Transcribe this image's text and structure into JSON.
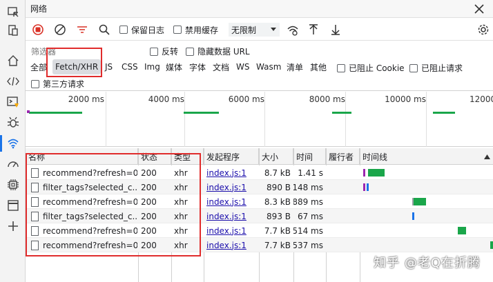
{
  "sidebar": {
    "icons": [
      "inspect-icon",
      "device-icon",
      "home-icon",
      "elements-icon",
      "console-icon",
      "sources-icon",
      "network-icon",
      "performance-icon",
      "memory-icon",
      "application-icon",
      "add-icon"
    ]
  },
  "panel": {
    "title": "网络"
  },
  "toolbar": {
    "preserve_log": "保留日志",
    "disable_cache": "禁用缓存",
    "throttle": "无限制"
  },
  "filter": {
    "placeholder": "筛选器",
    "invert": "反转",
    "hide_data_urls": "隐藏数据 URL",
    "types": [
      "全部",
      "Fetch/XHR",
      "JS",
      "CSS",
      "Img",
      "媒体",
      "字体",
      "文档",
      "WS",
      "Wasm",
      "清单",
      "其他"
    ],
    "selected": "Fetch/XHR",
    "blocked_cookies": "已阻止 Cookie",
    "blocked_requests": "已阻止请求",
    "third_party": "第三方请求"
  },
  "overview": {
    "ticks": [
      "2000 ms",
      "4000 ms",
      "6000 ms",
      "8000 ms",
      "10000 ms",
      "12000"
    ]
  },
  "table": {
    "headers": {
      "name": "名称",
      "status": "状态",
      "type": "类型",
      "initiator": "发起程序",
      "size": "大小",
      "time": "时间",
      "fulfilled_by": "履行者",
      "waterfall": "时间线"
    },
    "rows": [
      {
        "name": "recommend?refresh=0...",
        "status": "200",
        "type": "xhr",
        "initiator": "index.js:1",
        "size": "8.7 kB",
        "time": "1.41 s"
      },
      {
        "name": "filter_tags?selected_c...",
        "status": "200",
        "type": "xhr",
        "initiator": "index.js:1",
        "size": "890 B",
        "time": "148 ms"
      },
      {
        "name": "recommend?refresh=0...",
        "status": "200",
        "type": "xhr",
        "initiator": "index.js:1",
        "size": "8.3 kB",
        "time": "889 ms"
      },
      {
        "name": "filter_tags?selected_c...",
        "status": "200",
        "type": "xhr",
        "initiator": "index.js:1",
        "size": "893 B",
        "time": "67 ms"
      },
      {
        "name": "recommend?refresh=0...",
        "status": "200",
        "type": "xhr",
        "initiator": "index.js:1",
        "size": "7.7 kB",
        "time": "514 ms"
      },
      {
        "name": "recommend?refresh=0...",
        "status": "200",
        "type": "xhr",
        "initiator": "index.js:1",
        "size": "7.7 kB",
        "time": "537 ms"
      }
    ]
  },
  "watermark": "知乎 @老Q在折腾",
  "colors": {
    "accent": "#1a73e8",
    "highlight": "#e02b2b",
    "bar": "#1aa64a",
    "record": "#d93025"
  }
}
